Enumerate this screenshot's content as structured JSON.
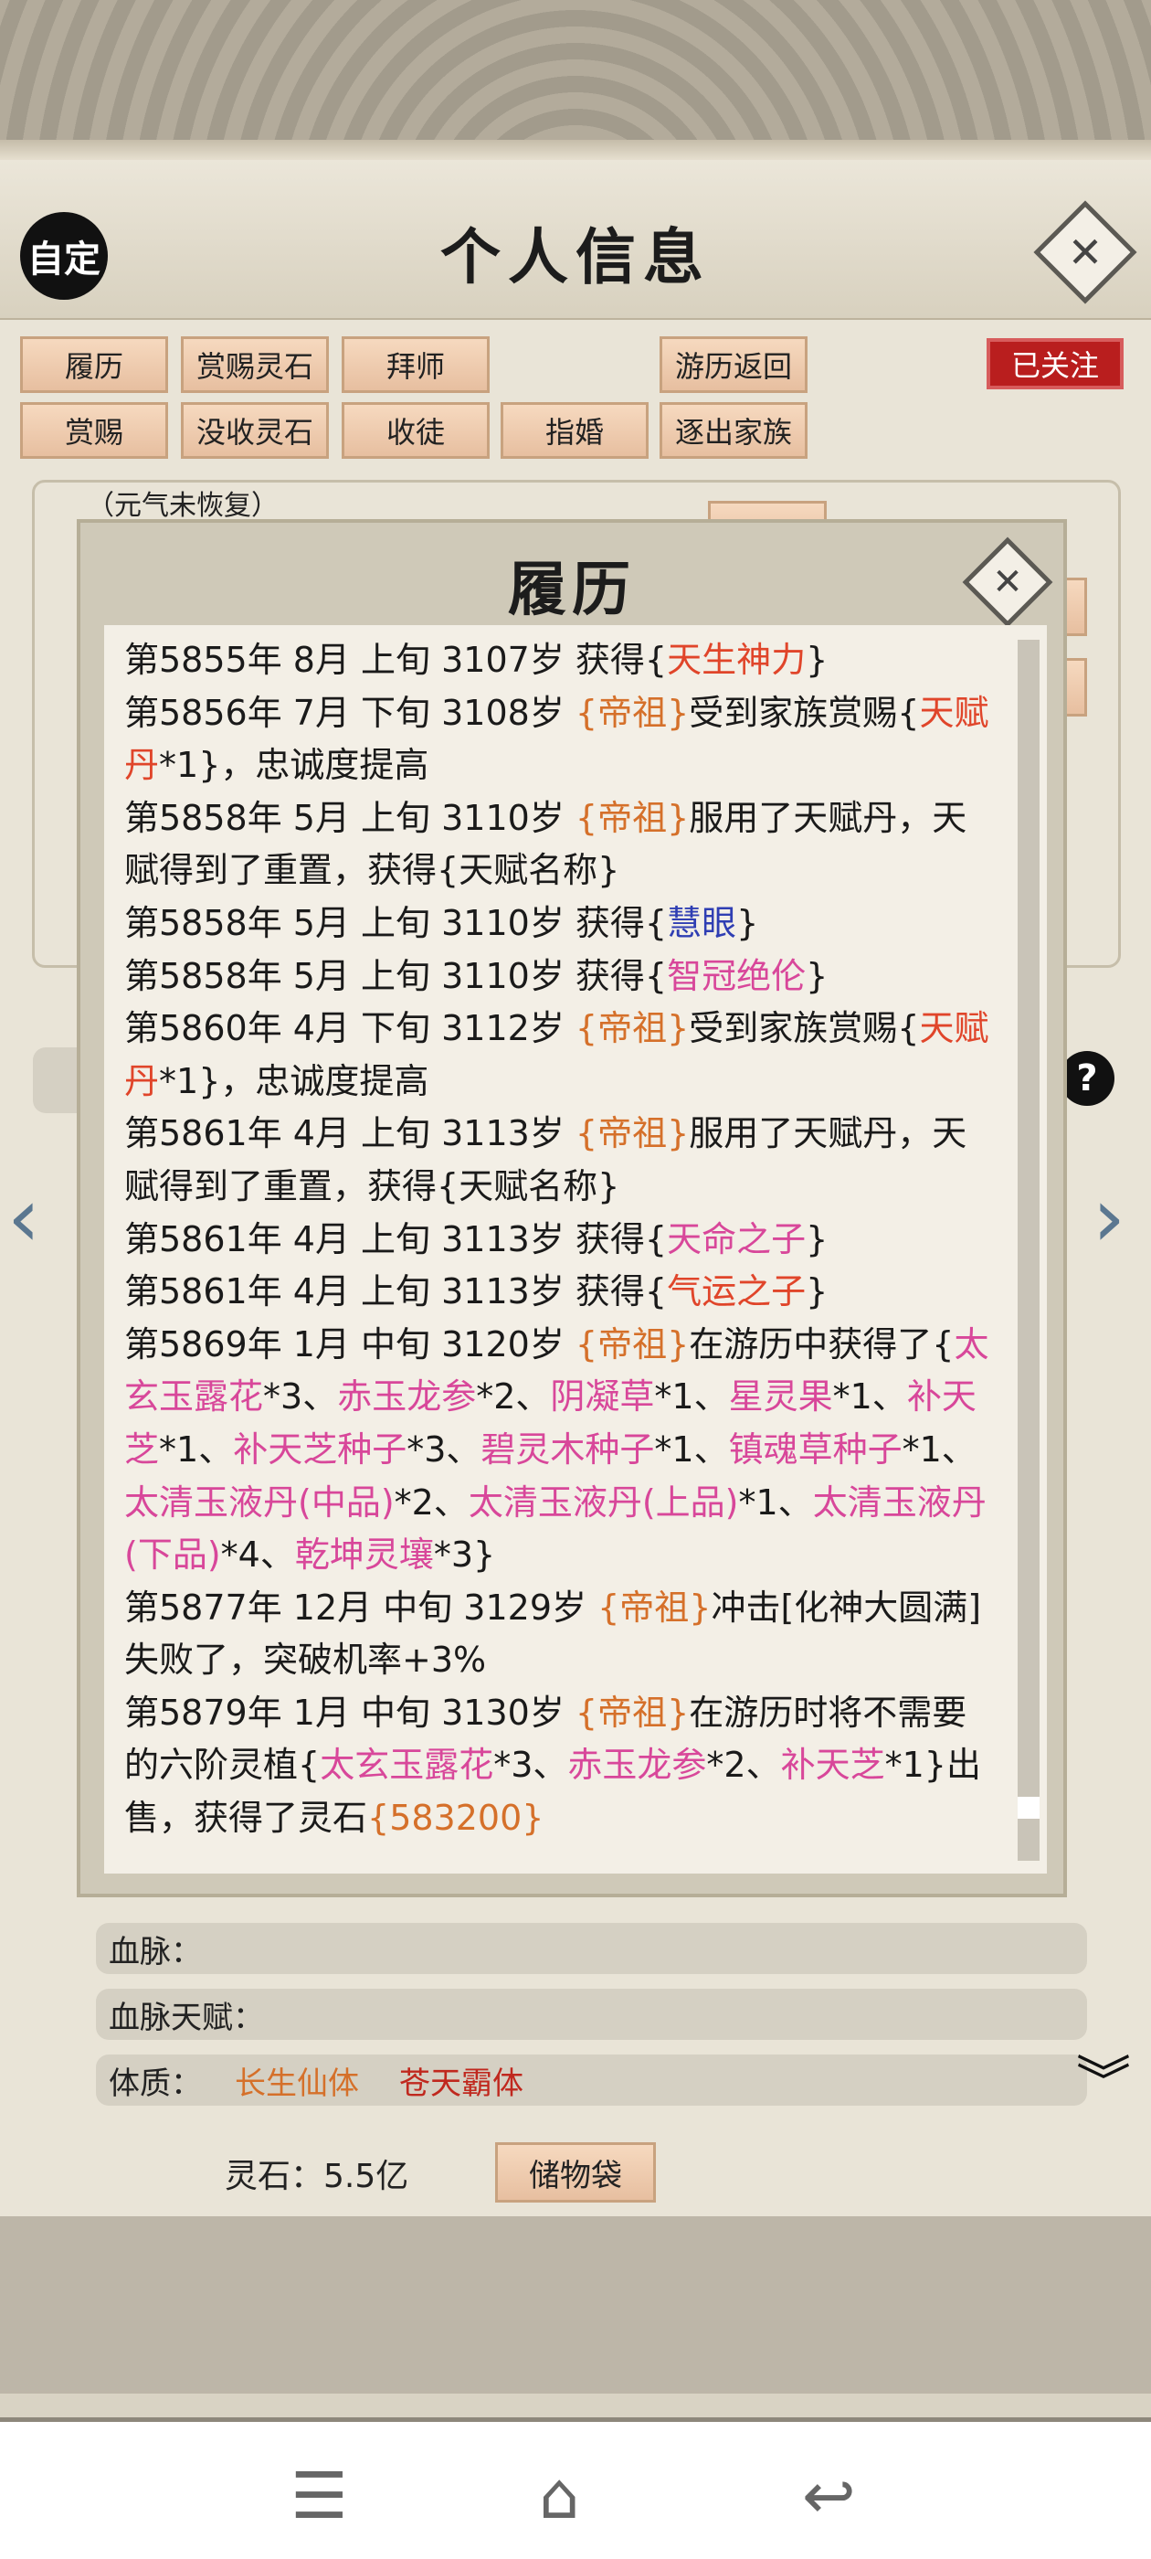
{
  "header": {
    "avatar_label": "自定",
    "title": "个人信息"
  },
  "actions": [
    "履历",
    "赏赐灵石",
    "拜师",
    "游历返回",
    "赏赐",
    "没收灵石",
    "收徒",
    "指婚",
    "逐出家族"
  ],
  "follow_badge": "已关注",
  "behind": {
    "status_note": "（元气未恢复）",
    "bloodline": "血脉：",
    "bloodline_talent": "血脉天赋：",
    "physique_label": "体质：",
    "physique_1": "长生仙体",
    "physique_2": "苍天霸体",
    "spirit_stones": "灵石：5.5亿",
    "bag_button": "储物袋"
  },
  "modal": {
    "title": "履历",
    "entries": [
      [
        {
          "t": "第5855年 8月 上旬  3107岁  获得{"
        },
        {
          "t": "天生神力",
          "c": "red"
        },
        {
          "t": "}"
        }
      ],
      [
        {
          "t": "第5856年 7月 下旬  3108岁  "
        },
        {
          "t": "{帝祖}",
          "c": "gold"
        },
        {
          "t": "受到家族赏赐{"
        },
        {
          "t": "天赋丹",
          "c": "red"
        },
        {
          "t": "*1}，忠诚度提高"
        }
      ],
      [
        {
          "t": "第5858年 5月 上旬  3110岁  "
        },
        {
          "t": "{帝祖}",
          "c": "gold"
        },
        {
          "t": "服用了天赋丹，天赋得到了重置，获得{天赋名称}"
        }
      ],
      [
        {
          "t": "第5858年  5月  上旬   3110岁   获得{"
        },
        {
          "t": "慧眼",
          "c": "blue"
        },
        {
          "t": "}"
        }
      ],
      [
        {
          "t": "第5858年  5月  上旬   3110岁   获得{"
        },
        {
          "t": "智冠绝伦",
          "c": "pink"
        },
        {
          "t": "}"
        }
      ],
      [
        {
          "t": "第5860年 4月 下旬  3112岁  "
        },
        {
          "t": "{帝祖}",
          "c": "gold"
        },
        {
          "t": "受到家族赏赐{"
        },
        {
          "t": "天赋丹",
          "c": "red"
        },
        {
          "t": "*1}，忠诚度提高"
        }
      ],
      [
        {
          "t": "第5861年 4月 上旬  3113岁  "
        },
        {
          "t": "{帝祖}",
          "c": "gold"
        },
        {
          "t": "服用了天赋丹，天赋得到了重置，获得{天赋名称}"
        }
      ],
      [
        {
          "t": "第5861年  4月  上旬   3113岁   获得{"
        },
        {
          "t": "天命之子",
          "c": "pink"
        },
        {
          "t": "}"
        }
      ],
      [
        {
          "t": "第5861年  4月  上旬   3113岁   获得{"
        },
        {
          "t": "气运之子",
          "c": "red"
        },
        {
          "t": "}"
        }
      ],
      [
        {
          "t": "第5869年 1月 中旬  3120岁  "
        },
        {
          "t": "{帝祖}",
          "c": "gold"
        },
        {
          "t": "在游历中获得了{"
        },
        {
          "t": "太玄玉露花",
          "c": "pink"
        },
        {
          "t": "*3、"
        },
        {
          "t": "赤玉龙参",
          "c": "pink"
        },
        {
          "t": "*2、"
        },
        {
          "t": "阴凝草",
          "c": "pink"
        },
        {
          "t": "*1、"
        },
        {
          "t": "星灵果",
          "c": "pink"
        },
        {
          "t": "*1、"
        },
        {
          "t": "补天芝",
          "c": "pink"
        },
        {
          "t": "*1、"
        },
        {
          "t": "补天芝种子",
          "c": "pink"
        },
        {
          "t": "*3、"
        },
        {
          "t": "碧灵木种子",
          "c": "pink"
        },
        {
          "t": "*1、"
        },
        {
          "t": "镇魂草种子",
          "c": "pink"
        },
        {
          "t": "*1、"
        },
        {
          "t": "太清玉液丹(中品)",
          "c": "pink"
        },
        {
          "t": "*2、"
        },
        {
          "t": "太清玉液丹(上品)",
          "c": "pink"
        },
        {
          "t": "*1、"
        },
        {
          "t": "太清玉液丹(下品)",
          "c": "pink"
        },
        {
          "t": "*4、"
        },
        {
          "t": "乾坤灵壤",
          "c": "pink"
        },
        {
          "t": "*3}"
        }
      ],
      [
        {
          "t": "第5877年  12月  中旬    3129岁    "
        },
        {
          "t": "{帝祖}",
          "c": "gold"
        },
        {
          "t": "冲击[化神大圆满]失败了，突破机率+3%"
        }
      ],
      [
        {
          "t": "第5879年 1月 中旬  3130岁  "
        },
        {
          "t": "{帝祖}",
          "c": "gold"
        },
        {
          "t": "在游历时将不需要的六阶灵植{"
        },
        {
          "t": "太玄玉露花",
          "c": "pink"
        },
        {
          "t": "*3、"
        },
        {
          "t": "赤玉龙参",
          "c": "pink"
        },
        {
          "t": "*2、"
        },
        {
          "t": "补天芝",
          "c": "pink"
        },
        {
          "t": "*1}出售，获得了灵石"
        },
        {
          "t": "{583200}",
          "c": "gold"
        }
      ]
    ]
  },
  "colors": {
    "gold": "#d5702a",
    "red": "#e0452a",
    "pink": "#d8479a",
    "blue": "#2f3eb3"
  },
  "icons": {
    "close": "close-icon",
    "help": "help-icon",
    "left_arrow": "chevron-left-icon",
    "right_arrow": "chevron-right-icon",
    "expand": "double-chevron-down-icon",
    "nav": [
      "menu-icon",
      "home-icon",
      "back-icon"
    ]
  }
}
